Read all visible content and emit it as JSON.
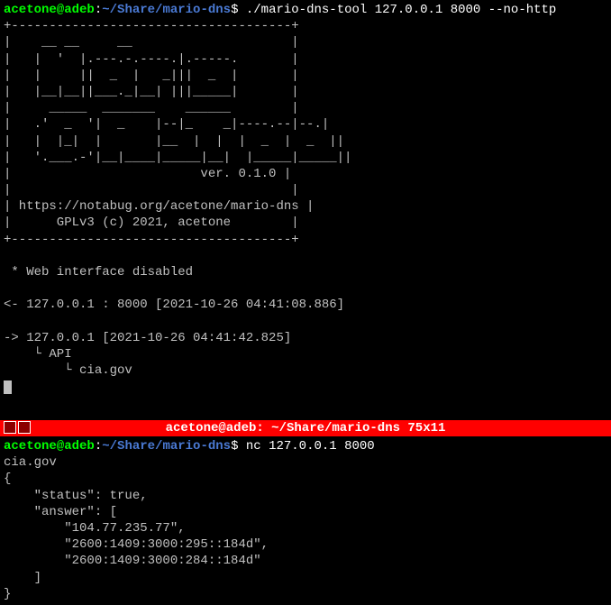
{
  "top": {
    "prompt": {
      "user_host": "acetone@adeb",
      "sep": ":",
      "tilde": "~",
      "path": "/Share/mario-dns",
      "dollar": "$ "
    },
    "command": "./mario-dns-tool 127.0.0.1 8000 --no-http",
    "ascii": "+-------------------------------------+\n|    __ __     __                     |\n|   |  '  |.---.-.----.|.-----.       |\n|   |     ||  _  |   _|||  _  |       |\n|   |__|__||___._|__| |||_____|       |\n|     _____  _______    ______        |\n|   .'  _  '|  _    |--|_    _|----.--|--.|\n|   |  |_|  |       |__  |  |  |  _  |  _  ||\n|   '.___.-'|__|____|_____|__|  |_____|_____||\n|                         ver. 0.1.0 |\n|                                     |",
    "url_line": "| https://notabug.org/acetone/mario-dns |",
    "gpl_line": "|      GPLv3 (c) 2021, acetone        |",
    "sep_line": "+-------------------------------------+",
    "blank": "",
    "disabled": " * Web interface disabled",
    "bind_line": "<- 127.0.0.1 : 8000 [2021-10-26 04:41:08.886]",
    "req_line": "-> 127.0.0.1 [2021-10-26 04:41:42.825]",
    "api_line": "    └ API",
    "host_line": "        └ cia.gov"
  },
  "titlebar": {
    "text": "acetone@adeb: ~/Share/mario-dns 75x11"
  },
  "bottom": {
    "prompt": {
      "user_host": "acetone@adeb",
      "sep": ":",
      "tilde": "~",
      "path": "/Share/mario-dns",
      "dollar": "$ "
    },
    "command": "nc 127.0.0.1 8000",
    "line1": "cia.gov",
    "line2": "{",
    "line3": "    \"status\": true,",
    "line4": "    \"answer\": [",
    "line5": "        \"104.77.235.77\",",
    "line6": "        \"2600:1409:3000:295::184d\",",
    "line7": "        \"2600:1409:3000:284::184d\"",
    "line8": "    ]",
    "line9": "}"
  }
}
